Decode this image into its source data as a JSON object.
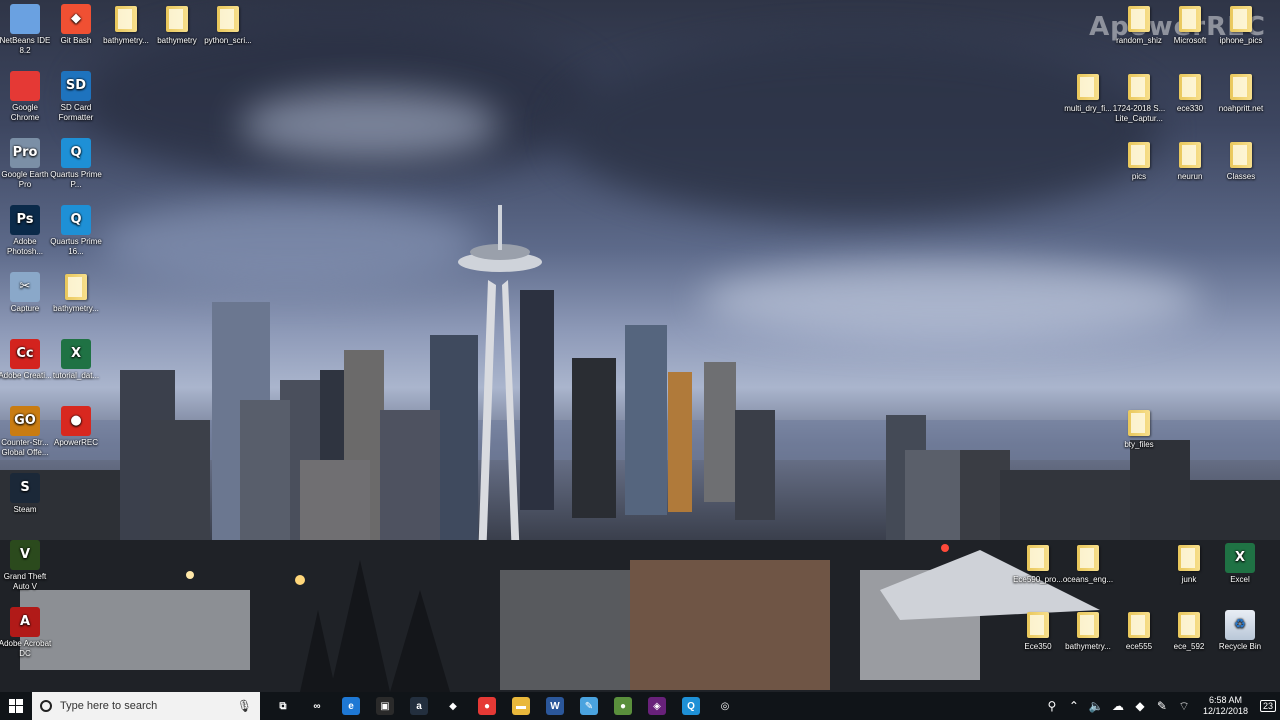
{
  "watermark": "ApowerREC",
  "left_column_1": [
    {
      "label": "NetBeans IDE 8.2",
      "icon": "netbeans-cube-icon",
      "color": "#6aa1e1",
      "glyph": ""
    },
    {
      "label": "Google Chrome",
      "icon": "chrome-icon",
      "color": "#e53935",
      "glyph": ""
    },
    {
      "label": "Google Earth Pro",
      "icon": "google-earth-icon",
      "color": "#7b8fa6",
      "glyph": "Pro"
    },
    {
      "label": "Adobe Photosh...",
      "icon": "photoshop-icon",
      "color": "#0b2a4a",
      "glyph": "Ps"
    },
    {
      "label": "Capture",
      "icon": "capture-icon",
      "color": "#8aa8c9",
      "glyph": "✂"
    },
    {
      "label": "Adobe Creati...",
      "icon": "creative-cloud-icon",
      "color": "#d3231e",
      "glyph": "Cc"
    },
    {
      "label": "Counter-Str... Global Offe...",
      "icon": "csgo-icon",
      "color": "#c97c12",
      "glyph": "GO"
    },
    {
      "label": "Steam",
      "icon": "steam-icon",
      "color": "#1b2838",
      "glyph": "S"
    },
    {
      "label": "Grand Theft Auto V",
      "icon": "gta-icon",
      "color": "#2b4a1d",
      "glyph": "V"
    },
    {
      "label": "Adobe Acrobat DC",
      "icon": "acrobat-icon",
      "color": "#b11a18",
      "glyph": "A"
    }
  ],
  "left_column_2": [
    {
      "label": "Git Bash",
      "icon": "git-bash-icon",
      "color": "#f05033",
      "glyph": "◆"
    },
    {
      "label": "SD Card Formatter",
      "icon": "sd-card-icon",
      "color": "#1e73be",
      "glyph": "SD"
    },
    {
      "label": "Quartus Prime P...",
      "icon": "quartus-icon",
      "color": "#1e90d6",
      "glyph": "Q"
    },
    {
      "label": "Quartus Prime 16...",
      "icon": "quartus-icon",
      "color": "#1e90d6",
      "glyph": "Q"
    },
    {
      "label": "bathymetry...",
      "icon": "document-icon",
      "color": "#f7df8c",
      "glyph": ""
    },
    {
      "label": "tutorial_dat...",
      "icon": "excel-file-icon",
      "color": "#1f7244",
      "glyph": "X"
    },
    {
      "label": "ApowerREC",
      "icon": "apowerrec-icon",
      "color": "#d8281f",
      "glyph": "●"
    }
  ],
  "top_row": [
    {
      "label": "bathymetry...",
      "icon": "folder-icon"
    },
    {
      "label": "bathymetry",
      "icon": "folder-icon"
    },
    {
      "label": "python_scri...",
      "icon": "folder-icon"
    }
  ],
  "right_row_1": [
    {
      "label": "random_shiz",
      "icon": "folder-icon"
    },
    {
      "label": "Microsoft",
      "icon": "folder-icon"
    },
    {
      "label": "iphone_pics",
      "icon": "folder-icon"
    }
  ],
  "right_row_2": [
    {
      "label": "multi_dry_fi...",
      "icon": "folder-icon"
    },
    {
      "label": "1724-2018 S... Lite_Captur...",
      "icon": "folder-icon"
    },
    {
      "label": "ece330",
      "icon": "folder-icon"
    },
    {
      "label": "noahpritt.net",
      "icon": "folder-icon"
    }
  ],
  "right_row_3": [
    {
      "label": "pics",
      "icon": "folder-icon"
    },
    {
      "label": "neurun",
      "icon": "folder-icon"
    },
    {
      "label": "Classes",
      "icon": "folder-icon"
    }
  ],
  "bty_files": {
    "label": "bty_files",
    "icon": "folder-icon"
  },
  "bottom_row_1": [
    {
      "label": "Ece590_pro...",
      "icon": "folder-icon"
    },
    {
      "label": "oceans_eng...",
      "icon": "folder-icon"
    },
    {
      "label": "junk",
      "icon": "folder-icon"
    },
    {
      "label": "Excel",
      "icon": "excel-icon"
    }
  ],
  "bottom_row_2": [
    {
      "label": "Ece350",
      "icon": "folder-icon"
    },
    {
      "label": "bathymetry...",
      "icon": "folder-icon"
    },
    {
      "label": "ece555",
      "icon": "folder-icon"
    },
    {
      "label": "ece_592",
      "icon": "folder-icon"
    },
    {
      "label": "Recycle Bin",
      "icon": "recycle-bin-icon"
    }
  ],
  "taskbar": {
    "search_placeholder": "Type here to search",
    "pinned": [
      {
        "name": "task-view-icon",
        "glyph": "⧉",
        "color": "transparent"
      },
      {
        "name": "infinity-icon",
        "glyph": "∞",
        "color": "transparent"
      },
      {
        "name": "edge-icon",
        "glyph": "e",
        "color": "#1e78d4"
      },
      {
        "name": "store-icon",
        "glyph": "▣",
        "color": "#2a2a2a"
      },
      {
        "name": "amazon-icon",
        "glyph": "a",
        "color": "#232f3e"
      },
      {
        "name": "dropbox-icon",
        "glyph": "◆",
        "color": "transparent"
      },
      {
        "name": "chrome-icon",
        "glyph": "●",
        "color": "#e53935"
      },
      {
        "name": "file-explorer-icon",
        "glyph": "▬",
        "color": "#e9b83b"
      },
      {
        "name": "word-icon",
        "glyph": "W",
        "color": "#2b579a"
      },
      {
        "name": "pen-app-icon",
        "glyph": "✎",
        "color": "#4aa3df"
      },
      {
        "name": "google-earth-icon",
        "glyph": "●",
        "color": "#5a8f3c"
      },
      {
        "name": "visual-studio-icon",
        "glyph": "◈",
        "color": "#68217a"
      },
      {
        "name": "search-app-icon",
        "glyph": "Q",
        "color": "#1e90d6"
      },
      {
        "name": "record-icon",
        "glyph": "◎",
        "color": "transparent"
      }
    ],
    "time": "6:58 AM",
    "date": "12/12/2018",
    "notifications": "23"
  }
}
